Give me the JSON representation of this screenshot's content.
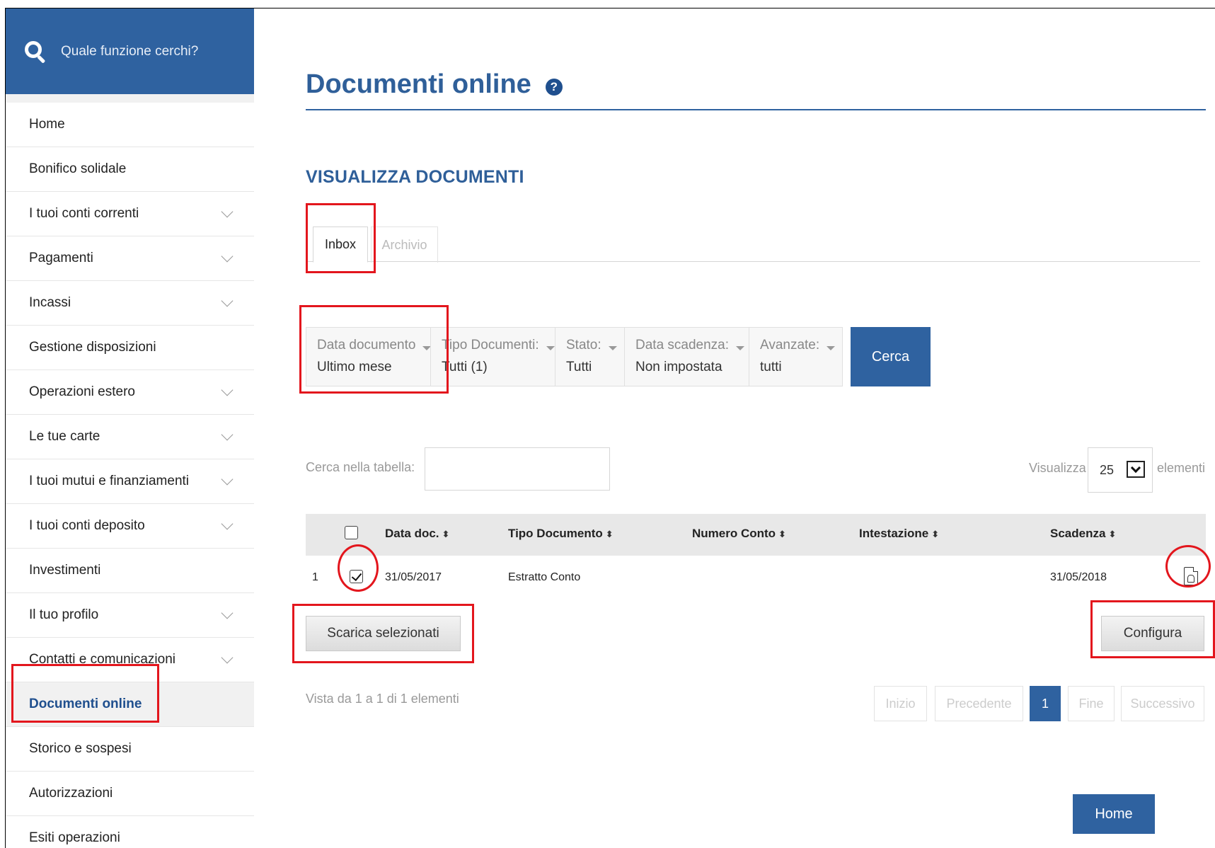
{
  "search": {
    "placeholder": "Quale funzione cerchi?"
  },
  "sidebar": {
    "items": [
      {
        "label": "Home",
        "expandable": false
      },
      {
        "label": "Bonifico solidale",
        "expandable": false
      },
      {
        "label": "I tuoi conti correnti",
        "expandable": true
      },
      {
        "label": "Pagamenti",
        "expandable": true
      },
      {
        "label": "Incassi",
        "expandable": true
      },
      {
        "label": "Gestione disposizioni",
        "expandable": false
      },
      {
        "label": "Operazioni estero",
        "expandable": true
      },
      {
        "label": "Le tue carte",
        "expandable": true
      },
      {
        "label": "I tuoi mutui e finanziamenti",
        "expandable": true
      },
      {
        "label": "I tuoi conti deposito",
        "expandable": true
      },
      {
        "label": "Investimenti",
        "expandable": false
      },
      {
        "label": "Il tuo profilo",
        "expandable": true
      },
      {
        "label": "Contatti e comunicazioni",
        "expandable": true
      },
      {
        "label": "Documenti online",
        "expandable": false,
        "active": true
      },
      {
        "label": "Storico e sospesi",
        "expandable": false
      },
      {
        "label": "Autorizzazioni",
        "expandable": false
      },
      {
        "label": "Esiti operazioni",
        "expandable": false
      }
    ]
  },
  "page": {
    "title": "Documenti online",
    "help_glyph": "?",
    "section_title": "VISUALIZZA DOCUMENTI"
  },
  "tabs": [
    {
      "label": "Inbox",
      "active": true
    },
    {
      "label": "Archivio",
      "active": false
    }
  ],
  "filters": [
    {
      "label": "Data documento",
      "value": "Ultimo mese"
    },
    {
      "label": "Tipo Documenti:",
      "value": "Tutti (1)"
    },
    {
      "label": "Stato:",
      "value": "Tutti"
    },
    {
      "label": "Data scadenza:",
      "value": "Non impostata"
    },
    {
      "label": "Avanzate:",
      "value": "tutti"
    }
  ],
  "search_button": "Cerca",
  "table_search": {
    "label": "Cerca nella tabella:",
    "value": ""
  },
  "page_size": {
    "prefix": "Visualizza",
    "value": "25",
    "suffix": "elementi"
  },
  "table": {
    "columns": [
      "Data doc.",
      "Tipo Documento",
      "Numero Conto",
      "Intestazione",
      "Scadenza"
    ],
    "sort_glyph": "⬍",
    "rows": [
      {
        "index": "1",
        "checked": true,
        "data_doc": "31/05/2017",
        "tipo": "Estratto Conto",
        "numero_conto": "",
        "intestazione": "",
        "scadenza": "31/05/2018"
      }
    ]
  },
  "actions": {
    "download_selected": "Scarica selezionati",
    "configure": "Configura"
  },
  "info": "Vista da 1 a 1 di 1 elementi",
  "pagination": {
    "first": "Inizio",
    "prev": "Precedente",
    "current": "1",
    "last": "Fine",
    "next": "Successivo"
  },
  "home_button": "Home",
  "colors": {
    "brand": "#2f62a0",
    "annotation": "#e3161d",
    "title": "#2f5f99"
  }
}
